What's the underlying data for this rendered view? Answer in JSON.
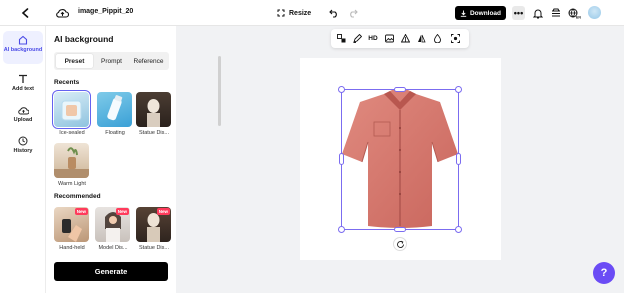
{
  "header": {
    "filename": "image_Pippit_20",
    "resize_label": "Resize",
    "download_label": "Download",
    "more_label": "•••"
  },
  "rail": {
    "items": [
      {
        "label": "AI background",
        "icon": "ai-background-icon",
        "active": true
      },
      {
        "label": "Add text",
        "icon": "text-icon"
      },
      {
        "label": "Upload",
        "icon": "upload-icon"
      },
      {
        "label": "History",
        "icon": "history-icon"
      }
    ]
  },
  "panel": {
    "title": "AI background",
    "tabs": [
      "Preset",
      "Prompt",
      "Reference"
    ],
    "recents_heading": "Recents",
    "recents": [
      {
        "caption": "Ice-sealed",
        "selected": true
      },
      {
        "caption": "Floating"
      },
      {
        "caption": "Statue Dis..."
      },
      {
        "caption": "Warm Light"
      }
    ],
    "recommended_heading": "Recommended",
    "recommended": [
      {
        "caption": "Hand-held",
        "badge": "New"
      },
      {
        "caption": "Model Dis...",
        "badge": "New"
      },
      {
        "caption": "Statue Dis...",
        "badge": "New"
      }
    ],
    "generate_label": "Generate"
  },
  "toolbar": {
    "hd_label": "HD"
  },
  "colors": {
    "accent": "#6b4cf5",
    "selection": "#7b6cf0",
    "shirt": "#d9786d"
  },
  "help": {
    "label": "?"
  }
}
